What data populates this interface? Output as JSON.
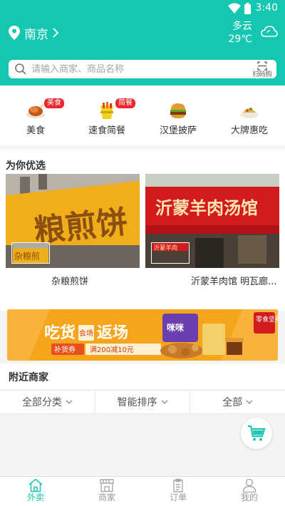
{
  "status": {
    "time": "3:40"
  },
  "header": {
    "city": "南京",
    "weather_text": "多云",
    "temperature": "29℃",
    "icons": [
      "location-pin-icon",
      "chevron-right-icon",
      "cloud-icon"
    ]
  },
  "search": {
    "placeholder": "请输入商家、商品名称",
    "scan_label": "扫码购"
  },
  "categories": [
    {
      "label": "美食",
      "tag": "美食",
      "icon": "roast-chicken-icon"
    },
    {
      "label": "速食简餐",
      "tag": "简餐",
      "icon": "fast-food-bag-icon"
    },
    {
      "label": "汉堡披萨",
      "tag": "",
      "icon": "burger-icon"
    },
    {
      "label": "大牌惠吃",
      "tag": "",
      "icon": "dish-icon"
    }
  ],
  "recommend": {
    "title": "为你优选",
    "items": [
      {
        "name": "杂粮煎饼",
        "sign_text": "杂粮煎饼"
      },
      {
        "name": "沂蒙羊肉馆 明瓦廊...",
        "sign_text": "沂蒙羊肉汤馆"
      }
    ]
  },
  "banner": {
    "headline_left": "吃货",
    "headline_mid": "会场",
    "headline_right": "返场",
    "coupon_tag": "补货券",
    "coupon_text": "满200减10元",
    "corner": "零食坚果",
    "brand": "咪咪"
  },
  "nearby": {
    "title": "附近商家"
  },
  "filters": [
    {
      "label": "全部分类"
    },
    {
      "label": "智能排序"
    },
    {
      "label": "全部"
    }
  ],
  "tabbar": [
    {
      "label": "外卖",
      "icon": "home-icon",
      "active": true
    },
    {
      "label": "商家",
      "icon": "store-icon",
      "active": false
    },
    {
      "label": "订单",
      "icon": "order-clipboard-icon",
      "active": false
    },
    {
      "label": "我的",
      "icon": "person-icon",
      "active": false
    }
  ],
  "colors": {
    "primary": "#15c6b0",
    "badge": "#f0262e",
    "banner": "#f6a41c"
  }
}
